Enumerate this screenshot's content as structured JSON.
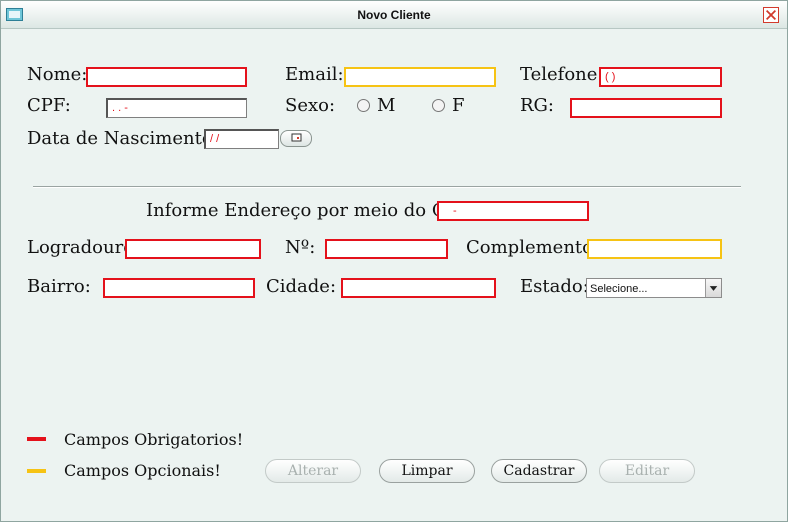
{
  "window": {
    "title": "Novo Cliente"
  },
  "colors": {
    "required": "#e4111b",
    "optional": "#f6c314"
  },
  "form": {
    "nome_label": "Nome:",
    "email_label": "Email:",
    "telefone_label": "Telefone:",
    "telefone_value": "( )",
    "cpf_label": "CPF:",
    "cpf_value": ".  .  -",
    "sexo_label": "Sexo:",
    "sexo_m": "M",
    "sexo_f": "F",
    "rg_label": "RG:",
    "nascimento_label": "Data de Nascimento:",
    "nascimento_value": "/ /",
    "cep_label": "Informe Endereço por meio do CEP:",
    "cep_value": "-",
    "logradouro_label": "Logradouro:",
    "numero_label": "Nº:",
    "complemento_label": "Complemento:",
    "bairro_label": "Bairro:",
    "cidade_label": "Cidade:",
    "estado_label": "Estado:",
    "estado_value": "Selecione..."
  },
  "legend": {
    "required": "Campos Obrigatorios!",
    "optional": "Campos Opcionais!"
  },
  "buttons": {
    "alterar": "Alterar",
    "limpar": "Limpar",
    "cadastrar": "Cadastrar",
    "editar": "Editar"
  }
}
